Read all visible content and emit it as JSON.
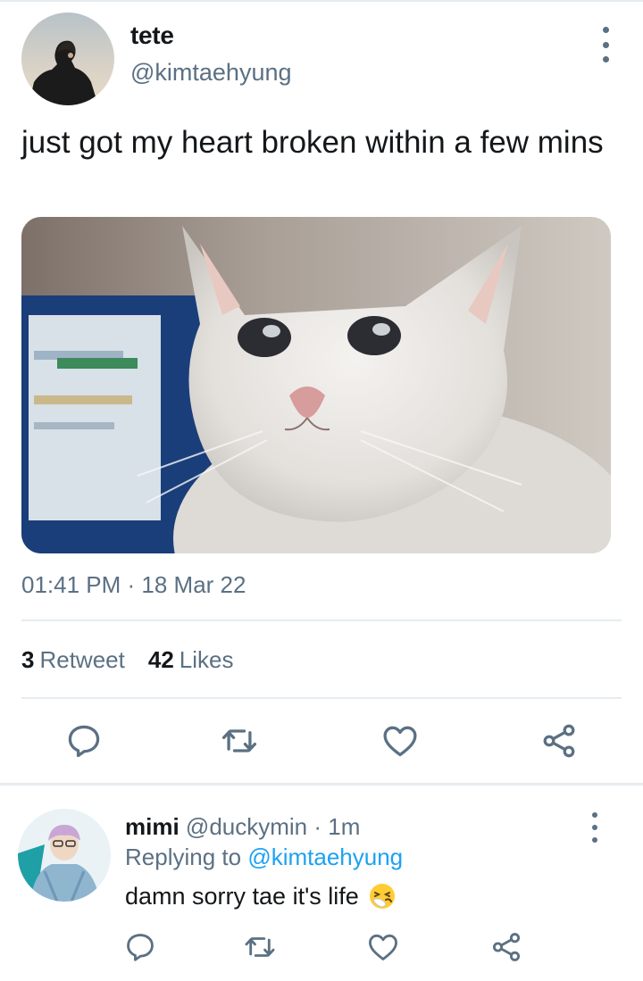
{
  "tweet": {
    "author_name": "tete",
    "author_handle": "@kimtaehyung",
    "text": "just got my heart broken within a few mins",
    "timestamp": "01:41 PM · 18 Mar 22",
    "retweet_count": "3",
    "retweet_label": "Retweet",
    "like_count": "42",
    "like_label": "Likes"
  },
  "reply": {
    "author_name": "mimi",
    "author_handle": "@duckymin",
    "time": " · 1m",
    "replying_prefix": "Replying to ",
    "replying_to": "@kimtaehyung",
    "text": "damn sorry tae it's life"
  },
  "icons": {
    "actions": [
      "reply-icon",
      "retweet-icon",
      "like-icon",
      "share-icon"
    ],
    "more": "more-vertical-icon",
    "emoji": "sneezing-face-emoji"
  },
  "colors": {
    "text": "#14171a",
    "secondary": "#5b7083",
    "link": "#1da1f2",
    "divider": "#e6ecf0"
  }
}
